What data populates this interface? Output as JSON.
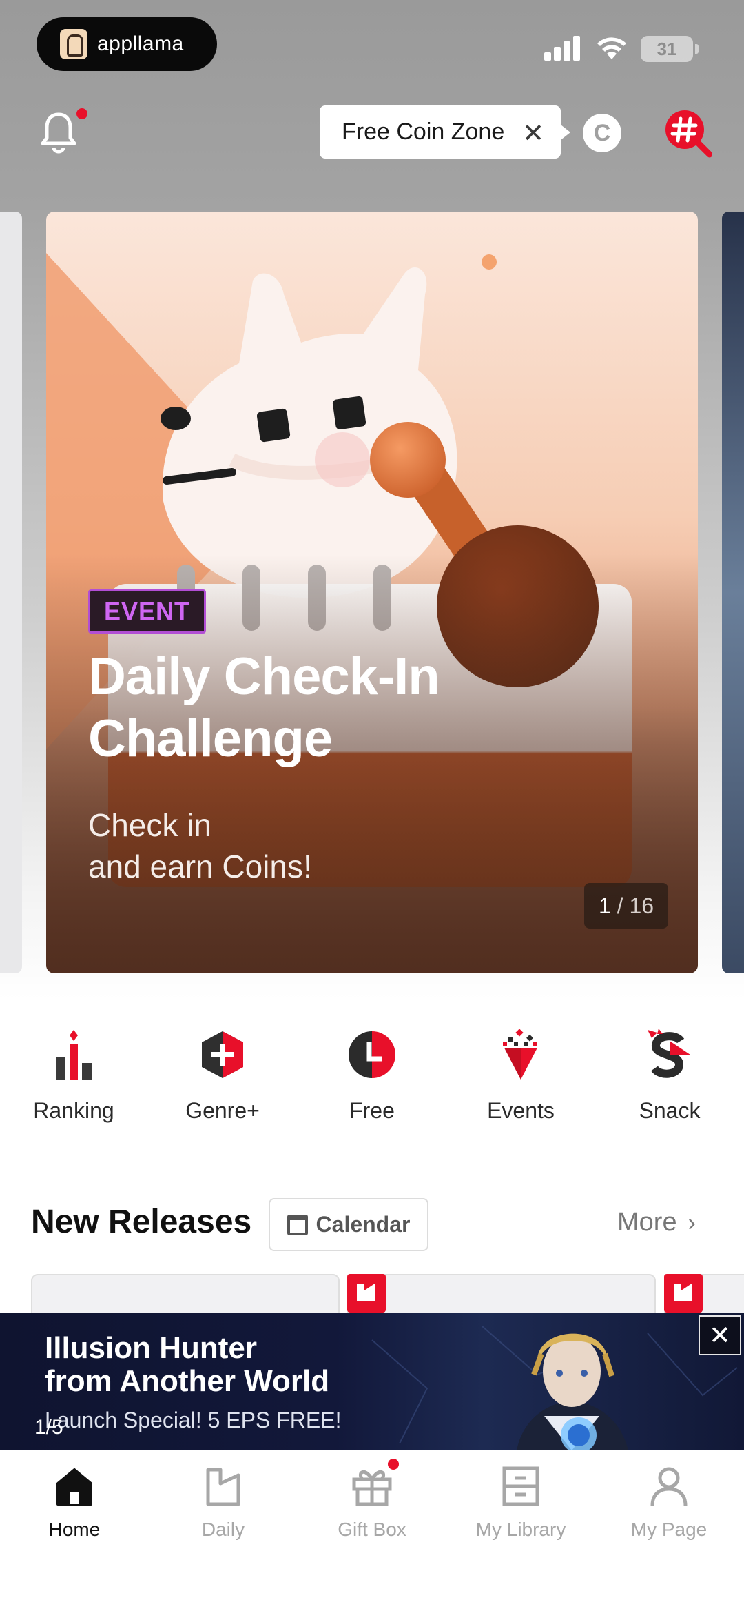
{
  "status_bar": {
    "app_name": "appllama",
    "battery": "31"
  },
  "header": {
    "tooltip_text": "Free Coin Zone",
    "coin_letter": "C",
    "tag_symbol": "#"
  },
  "hero": {
    "badge": "EVENT",
    "title": "Daily Check-In Challenge",
    "subtitle_line1": "Check in",
    "subtitle_line2": "and earn Coins!",
    "counter_current": "1",
    "counter_total": "/ 16"
  },
  "categories": [
    {
      "label": "Ranking",
      "icon": "ranking-icon"
    },
    {
      "label": "Genre+",
      "icon": "genre-plus-icon"
    },
    {
      "label": "Free",
      "icon": "free-clock-icon"
    },
    {
      "label": "Events",
      "icon": "events-icon"
    },
    {
      "label": "Snack",
      "icon": "snack-icon"
    }
  ],
  "new_releases": {
    "title": "New Releases",
    "calendar_label": "Calendar",
    "more_label": "More"
  },
  "promo": {
    "title_line1": "Illusion Hunter",
    "title_line2": "from Another World",
    "subtitle": "Launch Special! 5 EPS FREE!",
    "counter": "1/5",
    "close": "✕"
  },
  "tabs": [
    {
      "label": "Home",
      "icon": "home-icon",
      "active": true
    },
    {
      "label": "Daily",
      "icon": "daily-icon",
      "active": false
    },
    {
      "label": "Gift Box",
      "icon": "gift-box-icon",
      "active": false
    },
    {
      "label": "My Library",
      "icon": "library-icon",
      "active": false
    },
    {
      "label": "My Page",
      "icon": "profile-icon",
      "active": false
    }
  ],
  "colors": {
    "accent_red": "#e8102a",
    "event_purple": "#cf66f2"
  }
}
